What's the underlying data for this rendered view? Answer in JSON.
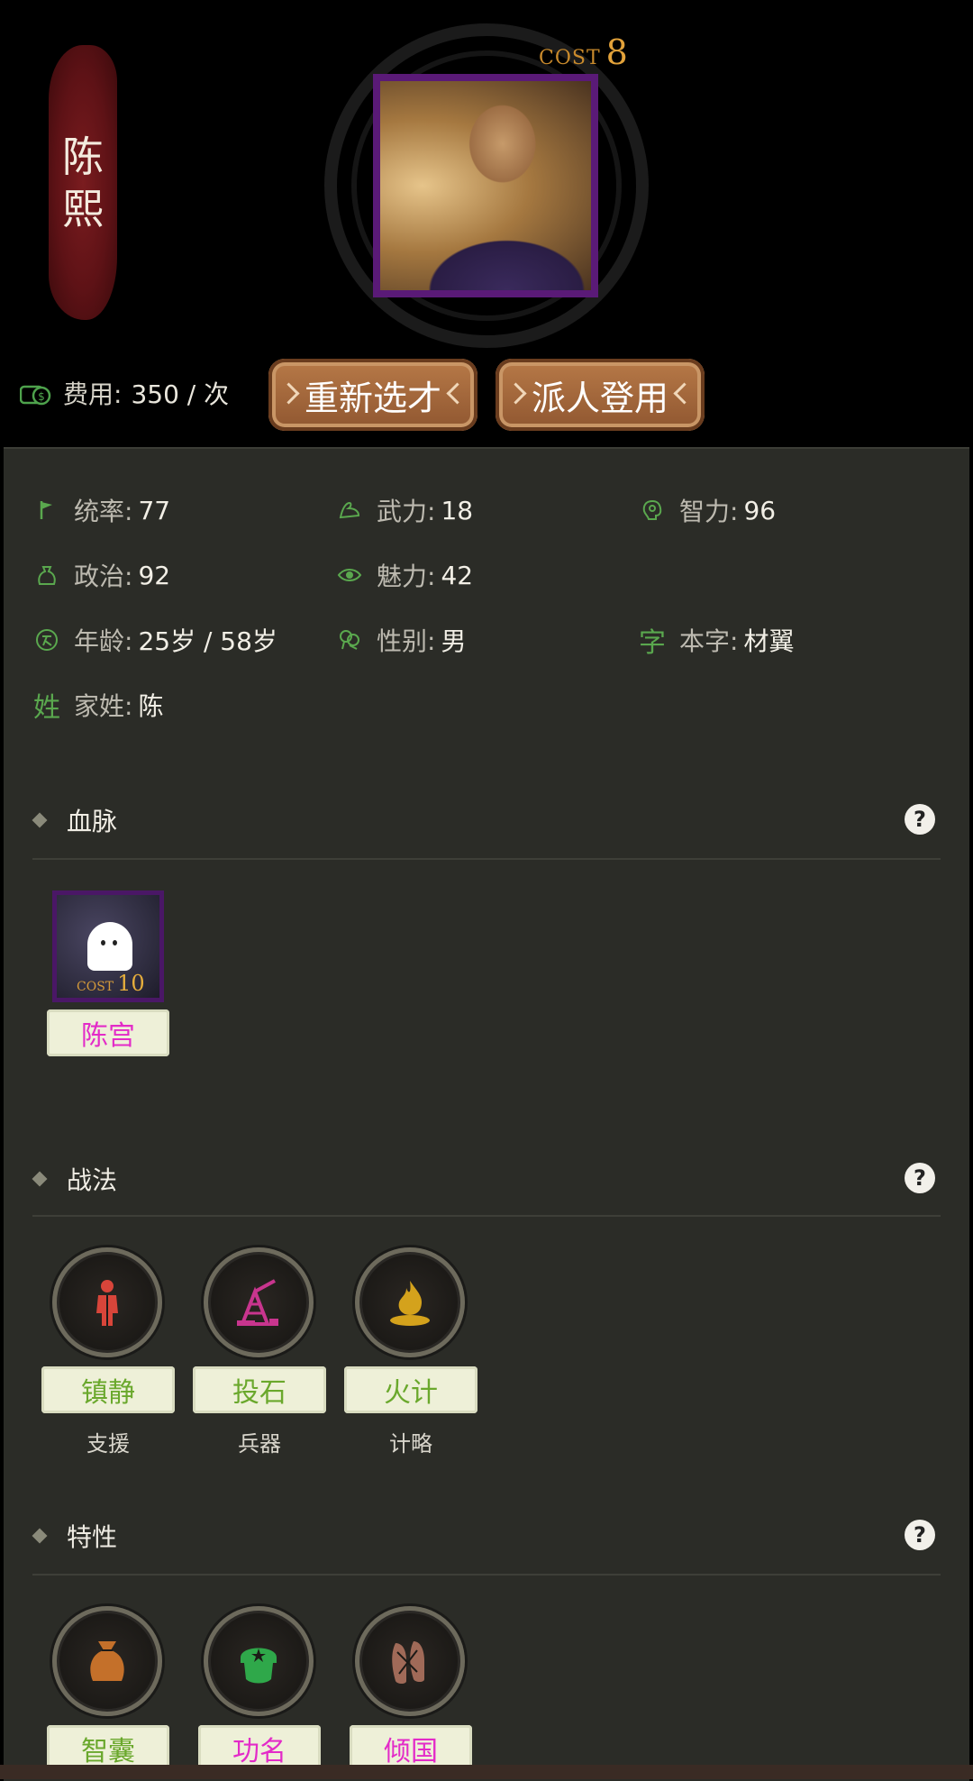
{
  "hero": {
    "name_chars": [
      "陈",
      "熙"
    ],
    "cost_label": "COST",
    "cost_value": "8"
  },
  "fee": {
    "label": "费用:",
    "value": "350 / 次",
    "icon": "coins-icon"
  },
  "buttons": {
    "reselect": "重新选才",
    "dispatch": "派人登用"
  },
  "stats": [
    {
      "icon": "flag-icon",
      "label": "统率:",
      "value": "77"
    },
    {
      "icon": "muscle-arm-icon",
      "label": "武力:",
      "value": "18"
    },
    {
      "icon": "brain-icon",
      "label": "智力:",
      "value": "96"
    },
    {
      "icon": "money-bag-icon",
      "label": "政治:",
      "value": "92"
    },
    {
      "icon": "eye-icon",
      "label": "魅力:",
      "value": "42"
    },
    {
      "icon": "age-icon",
      "label": "年龄:",
      "value": "25岁 / 58岁"
    },
    {
      "icon": "gender-icon",
      "label": "性别:",
      "value": "男"
    },
    {
      "icon_text": "字",
      "label": "本字:",
      "value": "材翼"
    },
    {
      "icon_text": "姓",
      "label": "家姓:",
      "value": "陈"
    }
  ],
  "lineage": {
    "title": "血脉",
    "help": "?",
    "items": [
      {
        "name": "陈宫",
        "cost_label": "COST",
        "cost_value": "10",
        "icon": "ghost-icon"
      }
    ]
  },
  "tactics": {
    "title": "战法",
    "help": "?",
    "items": [
      {
        "name": "镇静",
        "type": "支援",
        "icon": "calm-figure-icon",
        "color": "#d8453a"
      },
      {
        "name": "投石",
        "type": "兵器",
        "icon": "catapult-icon",
        "color": "#c8358e"
      },
      {
        "name": "火计",
        "type": "计略",
        "icon": "fire-icon",
        "color": "#d4a21c"
      }
    ]
  },
  "traits": {
    "title": "特性",
    "help": "?",
    "items": [
      {
        "name": "智囊",
        "icon": "sack-icon",
        "color": "#c4702a",
        "name_color": "green"
      },
      {
        "name": "功名",
        "icon": "star-cap-icon",
        "color": "#2fa84a",
        "name_color": "pink"
      },
      {
        "name": "倾国",
        "icon": "ballet-shoes-icon",
        "color": "#a06a58",
        "name_color": "pink"
      }
    ]
  }
}
